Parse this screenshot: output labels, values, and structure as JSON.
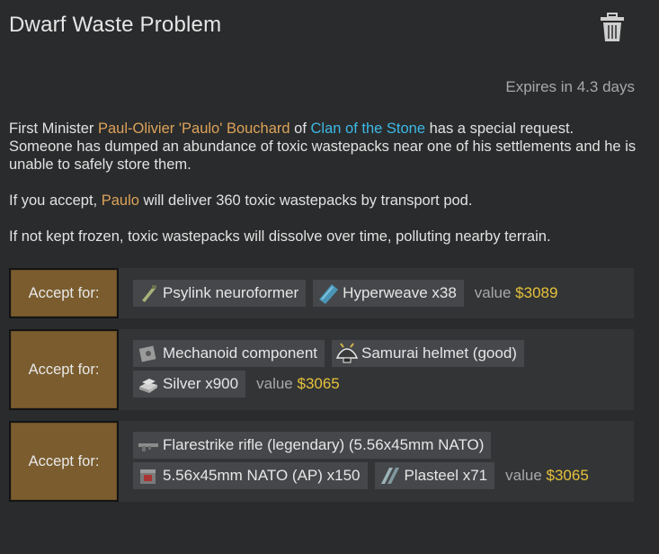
{
  "header": {
    "title": "Dwarf Waste Problem",
    "delete_icon": "trash-icon"
  },
  "expires": "Expires in 4.3 days",
  "description": {
    "p1_prefix": "First Minister ",
    "p1_person": "Paul-Olivier 'Paulo' Bouchard",
    "p1_of": " of ",
    "p1_faction": "Clan of the Stone",
    "p1_suffix": " has a special request. Someone has dumped an abundance of toxic wastepacks near one of his settlements and he is unable to safely store them.",
    "p2_prefix": "If you accept, ",
    "p2_person": "Paulo",
    "p2_suffix": " will deliver 360 toxic wastepacks by transport pod.",
    "p3": "If not kept frozen, toxic wastepacks will dissolve over time, polluting nearby terrain."
  },
  "options": [
    {
      "button": "Accept for:",
      "rewards": [
        {
          "label": "Psylink neuroformer",
          "icon": "neuroformer-icon"
        },
        {
          "label": "Hyperweave x38",
          "icon": "hyperweave-icon"
        }
      ],
      "value_label": "value",
      "value_amount": "$3089"
    },
    {
      "button": "Accept for:",
      "rewards": [
        {
          "label": "Mechanoid component",
          "icon": "mechanoid-component-icon"
        },
        {
          "label": "Samurai helmet (good)",
          "icon": "samurai-helmet-icon"
        },
        {
          "label": "Silver x900",
          "icon": "silver-icon"
        }
      ],
      "value_label": "value",
      "value_amount": "$3065"
    },
    {
      "button": "Accept for:",
      "rewards": [
        {
          "label": "Flarestrike rifle (legendary) (5.56x45mm NATO)",
          "icon": "rifle-icon"
        },
        {
          "label": "5.56x45mm NATO (AP) x150",
          "icon": "ammo-box-icon"
        },
        {
          "label": "Plasteel x71",
          "icon": "plasteel-icon"
        }
      ],
      "value_label": "value",
      "value_amount": "$3065"
    }
  ],
  "colors": {
    "background": "#2a2b2c",
    "person": "#dca35a",
    "faction": "#3cb9e6",
    "value_amount": "#e7c23a",
    "accept_button": "#7a5c2e"
  }
}
